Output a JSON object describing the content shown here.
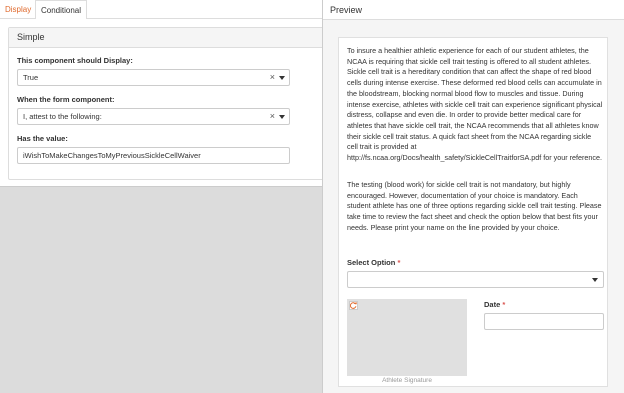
{
  "tabs": {
    "display": "Display",
    "conditional": "Conditional"
  },
  "card": {
    "title": "Simple",
    "display_label": "This component should Display:",
    "display_value": "True",
    "when_label": "When the form component:",
    "when_value": "I, attest to the following:",
    "value_label": "Has the value:",
    "value_input": "iWishToMakeChangesToMyPreviousSickleCellWaiver",
    "clear_glyph": "×"
  },
  "preview": {
    "title": "Preview",
    "paragraph1": "To insure a healthier athletic experience for each of our student athletes, the NCAA is requiring that sickle cell trait testing is offered to all student athletes. Sickle cell trait is a hereditary condition that can affect the shape of red blood cells during intense exercise. These deformed red blood cells can accumulate in the bloodstream, blocking normal blood flow to muscles and tissue. During intense exercise, athletes with sickle cell trait can experience significant physical distress, collapse and even die. In order to provide better medical care for athletes that have sickle cell trait, the NCAA recommends that all athletes know their sickle cell trait status. A quick fact sheet from the NCAA regarding sickle cell trait is provided at http://fs.ncaa.org/Docs/health_safety/SickleCellTraitforSA.pdf for your reference.",
    "paragraph2": "The testing (blood work) for sickle cell trait is not mandatory, but highly encouraged. However, documentation of your choice is mandatory. Each student athlete has one of three options regarding sickle cell trait testing. Please take time to review the fact sheet and check the option below that best fits your needs. Please print your name on the line provided by your choice.",
    "select_option_label": "Select Option",
    "required_mark": "*",
    "signature_caption": "Athlete Signature",
    "date_label": "Date"
  },
  "colors": {
    "accent": "#e06a2e",
    "required": "#d9534f"
  }
}
